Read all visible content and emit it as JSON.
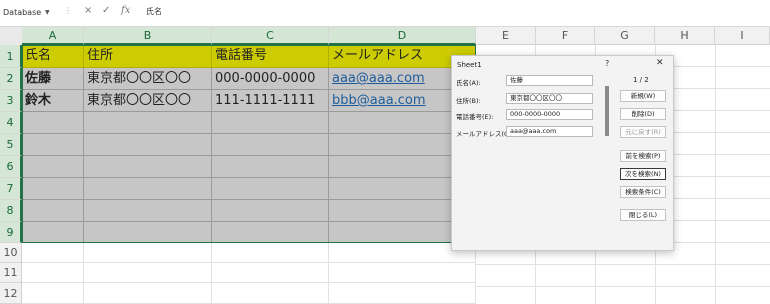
{
  "formula_bar": {
    "name_box": "Database",
    "cancel_icon": "×",
    "enter_icon": "✓",
    "fx_icon": "fx",
    "content": "氏名"
  },
  "columns": [
    "A",
    "B",
    "C",
    "D",
    "E",
    "F",
    "G",
    "H",
    "I"
  ],
  "rows": [
    "1",
    "2",
    "3",
    "4",
    "5",
    "6",
    "7",
    "8",
    "9",
    "10",
    "11",
    "12"
  ],
  "sheet": {
    "headers": [
      "氏名",
      "住所",
      "電話番号",
      "メールアドレス"
    ],
    "records": [
      {
        "name": "佐藤",
        "address": "東京都〇〇区〇〇",
        "phone": "000-0000-0000",
        "email": "aaa@aaa.com"
      },
      {
        "name": "鈴木",
        "address": "東京都〇〇区〇〇",
        "phone": "111-1111-1111",
        "email": "bbb@aaa.com"
      }
    ]
  },
  "dialog": {
    "title": "Sheet1",
    "help": "?",
    "close": "✕",
    "record_counter": "1 / 2",
    "fields": [
      {
        "label": "氏名(A):",
        "value": "佐藤"
      },
      {
        "label": "住所(B):",
        "value": "東京都〇〇区〇〇"
      },
      {
        "label": "電話番号(E):",
        "value": "000-0000-0000"
      },
      {
        "label": "メールアドレス(G):",
        "value": "aaa@aaa.com"
      }
    ],
    "buttons": {
      "new": "新規(W)",
      "delete": "削除(D)",
      "restore": "元に戻す(R)",
      "find_prev": "前を検索(P)",
      "find_next": "次を検索(N)",
      "criteria": "検索条件(C)",
      "close": "閉じる(L)"
    }
  },
  "colors": {
    "header_fill": "#cccc00",
    "body_fill": "#c6c6c6",
    "selection": "#217346",
    "link": "#1f5c9c"
  }
}
